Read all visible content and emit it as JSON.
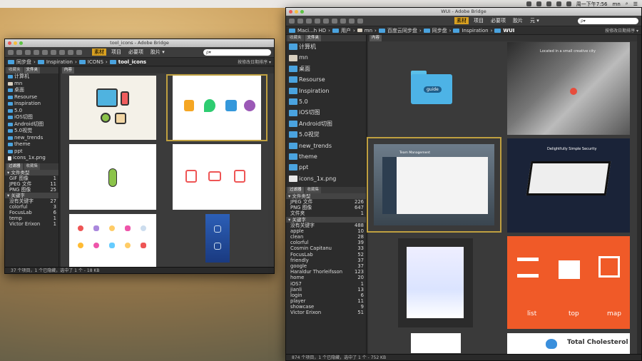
{
  "menubar": {
    "datetime": "周一下午7:56",
    "user": "mn"
  },
  "w1": {
    "title": "tool_icons - Adobe Bridge",
    "workspaces": [
      "素材",
      "项目",
      "必要项",
      "胶片 ▾"
    ],
    "active_workspace": "素材",
    "search_placeholder": "ρ▾",
    "path": [
      "同步盘",
      "Inspiration",
      "ICONS",
      "tool_icons"
    ],
    "sort": "按修改日期排序 ▾",
    "panel_tabs": [
      "收藏夹",
      "文件夹"
    ],
    "folders": [
      "计算机",
      "mn",
      "桌面",
      "Resourse",
      "Inspiration",
      "5.0",
      "iOS切图",
      "Android切图",
      "5.0视觉",
      "new_trends",
      "theme",
      "ppt",
      "icons_1x.png"
    ],
    "filter_tabs": [
      "过滤器",
      "收藏集"
    ],
    "filter_groups": [
      {
        "title": "▾ 文件类型",
        "rows": [
          [
            "GIF 图像",
            "1"
          ],
          [
            "JPEG 文件",
            "11"
          ],
          [
            "PNG 图像",
            "25"
          ]
        ]
      },
      {
        "title": "▾ 关键字",
        "rows": [
          [
            "没有关键字",
            "27"
          ],
          [
            "colorful",
            "3"
          ],
          [
            "FocusLab",
            "6"
          ],
          [
            "temp",
            "1"
          ],
          [
            "Victor Erixon",
            "1"
          ]
        ]
      }
    ],
    "status": "37 个项目，1 个已隐藏，选中了 1 个 - 18 KB"
  },
  "w2": {
    "title": "WUI - Adobe Bridge",
    "workspaces": [
      "素材",
      "项目",
      "必要项",
      "胶片",
      "元 ▾"
    ],
    "active_workspace": "素材",
    "search_placeholder": "ρ▾",
    "path": [
      "Maci...h HD",
      "用户",
      "mn",
      "百度云同步盘",
      "同步盘",
      "Inspiration",
      "WUI"
    ],
    "sort": "按修改日期排序 ▾",
    "panel_tabs": [
      "收藏夹",
      "文件夹"
    ],
    "folders": [
      "计算机",
      "mn",
      "桌面",
      "Resourse",
      "Inspiration",
      "5.0",
      "iOS切图",
      "Android切图",
      "5.0视觉",
      "new_trends",
      "theme",
      "ppt",
      "icons_1x.png"
    ],
    "filter_tabs": [
      "过滤器",
      "收藏集"
    ],
    "filter_groups": [
      {
        "title": "▾ 文件类型",
        "rows": [
          [
            "JPEG 文件",
            "226"
          ],
          [
            "PNG 图像",
            "647"
          ],
          [
            "文件夹",
            "1"
          ]
        ]
      },
      {
        "title": "▾ 关键字",
        "rows": [
          [
            "没有关键字",
            "488"
          ],
          [
            "apple",
            "10"
          ],
          [
            "clean",
            "28"
          ],
          [
            "colorful",
            "39"
          ],
          [
            "Cosmin Capitanu",
            "33"
          ],
          [
            "FocusLab",
            "52"
          ],
          [
            "friendly",
            "37"
          ],
          [
            "google",
            "37"
          ],
          [
            "Haraldur Thorleifsson",
            "123"
          ],
          [
            "home",
            "20"
          ],
          [
            "iOS7",
            "1"
          ],
          [
            "jianli",
            "13"
          ],
          [
            "login",
            "6"
          ],
          [
            "player",
            "11"
          ],
          [
            "showcase",
            "9"
          ],
          [
            "Victor Erixon",
            "51"
          ]
        ]
      }
    ],
    "thumb_labels": {
      "folder": "guide",
      "map_hero": "Located in a small creative city",
      "dash": "Team Management",
      "security": "Delightfully Simple Security",
      "list": "list",
      "top": "top",
      "map": "map",
      "cholesterol": "Total Cholesterol"
    },
    "status": "874 个项目，1 个已隐藏，选中了 1 个 - 752 KB"
  }
}
